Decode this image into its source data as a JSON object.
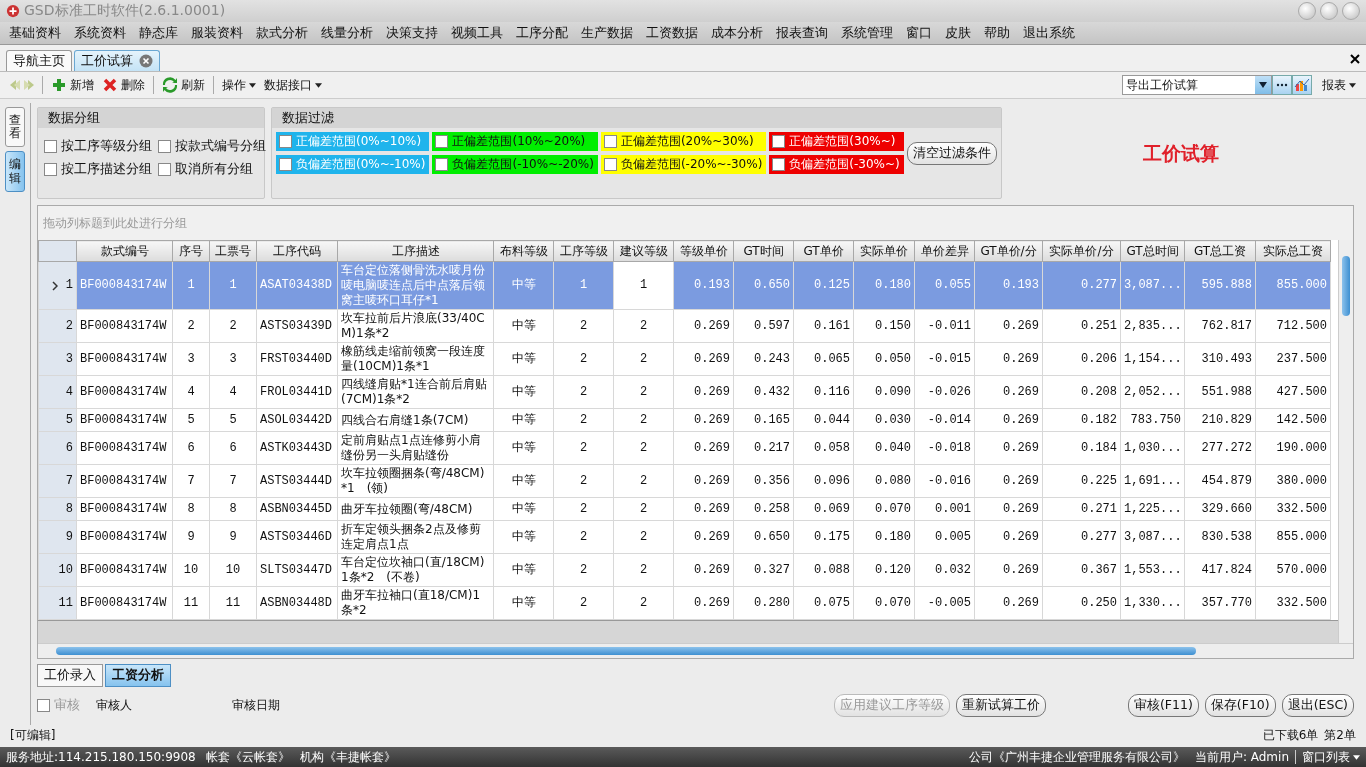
{
  "window": {
    "title": "GSD标准工时软件(2.6.1.0001)"
  },
  "menu": [
    "基础资料",
    "系统资料",
    "静态库",
    "服装资料",
    "款式分析",
    "线量分析",
    "决策支持",
    "视频工具",
    "工序分配",
    "生产数据",
    "工资数据",
    "成本分析",
    "报表查询",
    "系统管理",
    "窗口",
    "皮肤",
    "帮助",
    "退出系统"
  ],
  "doc_tabs": [
    {
      "label": "导航主页",
      "selected": false,
      "closable": false
    },
    {
      "label": "工价试算",
      "selected": true,
      "closable": true
    }
  ],
  "toolbar": {
    "buttons": [
      {
        "label": "新增",
        "kind": "add"
      },
      {
        "label": "删除",
        "kind": "delete"
      },
      {
        "label": "刷新",
        "kind": "refresh"
      }
    ],
    "menus": [
      "操作",
      "数据接口"
    ],
    "export_combo": {
      "value": "导出工价试算"
    },
    "report_menu": "报表"
  },
  "side_tabs": [
    {
      "label": "查看",
      "selected": false
    },
    {
      "label": "编辑",
      "selected": true
    }
  ],
  "grouping": {
    "title": "数据分组",
    "options": [
      {
        "label": "按工序等级分组",
        "checked": false
      },
      {
        "label": "按款式编号分组",
        "checked": false
      },
      {
        "label": "按工序描述分组",
        "checked": false
      },
      {
        "label": "取消所有分组",
        "checked": false
      }
    ]
  },
  "filtering": {
    "title": "数据过滤",
    "clear_button": "清空过滤条件",
    "filters": [
      {
        "label": "正偏差范围(0%~10%)",
        "color": "#1fb4ec",
        "checked": false
      },
      {
        "label": "正偏差范围(10%~20%)",
        "color": "#00ee00",
        "checked": false
      },
      {
        "label": "正偏差范围(20%~30%)",
        "color": "#ffff00",
        "checked": false
      },
      {
        "label": "正偏差范围(30%~)",
        "color": "#ee0000",
        "checked": false
      },
      {
        "label": "负偏差范围(0%~-10%)",
        "color": "#1fb4ec",
        "checked": false
      },
      {
        "label": "负偏差范围(-10%~-20%)",
        "color": "#00ee00",
        "checked": false
      },
      {
        "label": "负偏差范围(-20%~-30%)",
        "color": "#ffff00",
        "checked": false
      },
      {
        "label": "负偏差范围(-30%~)",
        "color": "#ee0000",
        "checked": false
      }
    ]
  },
  "page_title": "工价试算",
  "table": {
    "group_hint": "拖动列标题到此处进行分组",
    "columns": [
      {
        "label": "款式编号",
        "editable": false
      },
      {
        "label": "序号",
        "editable": false
      },
      {
        "label": "工票号",
        "editable": false
      },
      {
        "label": "工序代码",
        "editable": false
      },
      {
        "label": "工序描述",
        "editable": false
      },
      {
        "label": "布料等级",
        "editable": false
      },
      {
        "label": "工序等级",
        "editable": false
      },
      {
        "label": "建议等级",
        "editable": true
      },
      {
        "label": "等级单价",
        "editable": false
      },
      {
        "label": "GT时间",
        "editable": false
      },
      {
        "label": "GT单价",
        "editable": false
      },
      {
        "label": "实际单价",
        "editable": false
      },
      {
        "label": "单价差异",
        "editable": false
      },
      {
        "label": "GT单价/分",
        "editable": false
      },
      {
        "label": "实际单价/分",
        "editable": false
      },
      {
        "label": "GT总时间",
        "editable": false
      },
      {
        "label": "GT总工资",
        "editable": false
      },
      {
        "label": "实际总工资",
        "editable": false
      }
    ],
    "rows": [
      {
        "row_number": "1",
        "selected": true,
        "cells": [
          "BF000843174W",
          "1",
          "1",
          "ASAT03438D",
          "车台定位落侧骨洗水唛月份唛电脑唛连点后中点落后领窝主唛环口耳仔*1",
          "中等",
          "1",
          "1",
          "0.193",
          "0.650",
          "0.125",
          "0.180",
          "0.055",
          "0.193",
          "0.277",
          "3,087...",
          "595.888",
          "855.000"
        ]
      },
      {
        "row_number": "2",
        "selected": false,
        "cells": [
          "BF000843174W",
          "2",
          "2",
          "ASTS03439D",
          "坎车拉前后片浪底(33/40CM)1条*2",
          "中等",
          "2",
          "2",
          "0.269",
          "0.597",
          "0.161",
          "0.150",
          "-0.011",
          "0.269",
          "0.251",
          "2,835...",
          "762.817",
          "712.500"
        ]
      },
      {
        "row_number": "3",
        "selected": false,
        "cells": [
          "BF000843174W",
          "3",
          "3",
          "FRST03440D",
          "橡筋线走缩前领窝一段连度量(10CM)1条*1",
          "中等",
          "2",
          "2",
          "0.269",
          "0.243",
          "0.065",
          "0.050",
          "-0.015",
          "0.269",
          "0.206",
          "1,154...",
          "310.493",
          "237.500"
        ]
      },
      {
        "row_number": "4",
        "selected": false,
        "cells": [
          "BF000843174W",
          "4",
          "4",
          "FROL03441D",
          "四线缝肩贴*1连合前后肩贴(7CM)1条*2",
          "中等",
          "2",
          "2",
          "0.269",
          "0.432",
          "0.116",
          "0.090",
          "-0.026",
          "0.269",
          "0.208",
          "2,052...",
          "551.988",
          "427.500"
        ]
      },
      {
        "row_number": "5",
        "selected": false,
        "cells": [
          "BF000843174W",
          "5",
          "5",
          "ASOL03442D",
          "四线合右肩缝1条(7CM)",
          "中等",
          "2",
          "2",
          "0.269",
          "0.165",
          "0.044",
          "0.030",
          "-0.014",
          "0.269",
          "0.182",
          "783.750",
          "210.829",
          "142.500"
        ]
      },
      {
        "row_number": "6",
        "selected": false,
        "cells": [
          "BF000843174W",
          "6",
          "6",
          "ASTK03443D",
          "定前肩贴点1点连修剪小肩缝份另一头肩贴缝份",
          "中等",
          "2",
          "2",
          "0.269",
          "0.217",
          "0.058",
          "0.040",
          "-0.018",
          "0.269",
          "0.184",
          "1,030...",
          "277.272",
          "190.000"
        ]
      },
      {
        "row_number": "7",
        "selected": false,
        "cells": [
          "BF000843174W",
          "7",
          "7",
          "ASTS03444D",
          "坎车拉领圈捆条(弯/48CM)*1　(领)",
          "中等",
          "2",
          "2",
          "0.269",
          "0.356",
          "0.096",
          "0.080",
          "-0.016",
          "0.269",
          "0.225",
          "1,691...",
          "454.879",
          "380.000"
        ]
      },
      {
        "row_number": "8",
        "selected": false,
        "cells": [
          "BF000843174W",
          "8",
          "8",
          "ASBN03445D",
          "曲牙车拉领圈(弯/48CM)",
          "中等",
          "2",
          "2",
          "0.269",
          "0.258",
          "0.069",
          "0.070",
          "0.001",
          "0.269",
          "0.271",
          "1,225...",
          "329.660",
          "332.500"
        ]
      },
      {
        "row_number": "9",
        "selected": false,
        "cells": [
          "BF000843174W",
          "9",
          "9",
          "ASTS03446D",
          "折车定领头捆条2点及修剪连定肩点1点",
          "中等",
          "2",
          "2",
          "0.269",
          "0.650",
          "0.175",
          "0.180",
          "0.005",
          "0.269",
          "0.277",
          "3,087...",
          "830.538",
          "855.000"
        ]
      },
      {
        "row_number": "10",
        "selected": false,
        "cells": [
          "BF000843174W",
          "10",
          "10",
          "SLTS03447D",
          "车台定位坎袖口(直/18CM)1条*2　(不卷)",
          "中等",
          "2",
          "2",
          "0.269",
          "0.327",
          "0.088",
          "0.120",
          "0.032",
          "0.269",
          "0.367",
          "1,553...",
          "417.824",
          "570.000"
        ]
      },
      {
        "row_number": "11",
        "selected": false,
        "cells": [
          "BF000843174W",
          "11",
          "11",
          "ASBN03448D",
          "曲牙车拉袖口(直18/CM)1条*2",
          "中等",
          "2",
          "2",
          "0.269",
          "0.280",
          "0.075",
          "0.070",
          "-0.005",
          "0.269",
          "0.250",
          "1,330...",
          "357.770",
          "332.500"
        ]
      }
    ]
  },
  "bottom_tabs": [
    {
      "label": "工价录入",
      "selected": false
    },
    {
      "label": "工资分析",
      "selected": true
    }
  ],
  "approval": {
    "checkbox": {
      "label": "审核",
      "checked": false,
      "disabled": true
    },
    "reviewer_label": "审核人",
    "date_label": "审核日期",
    "buttons": [
      {
        "label": "应用建议工序等级",
        "disabled": true
      },
      {
        "label": "重新试算工价",
        "disabled": false
      }
    ],
    "right_buttons": [
      "审核(F11)",
      "保存(F10)",
      "退出(ESC)"
    ]
  },
  "mode": "[可编辑]",
  "download_info": "已下载6单",
  "current_doc": "第2单",
  "status_bar": {
    "server": "服务地址:114.215.180.150:9908",
    "account_set": "帐套《云帐套》",
    "org": "机构《丰捷帐套》",
    "company": "公司《广州丰捷企业管理服务有限公司》",
    "user": "当前用户: Admin",
    "window_list": "窗口列表"
  }
}
